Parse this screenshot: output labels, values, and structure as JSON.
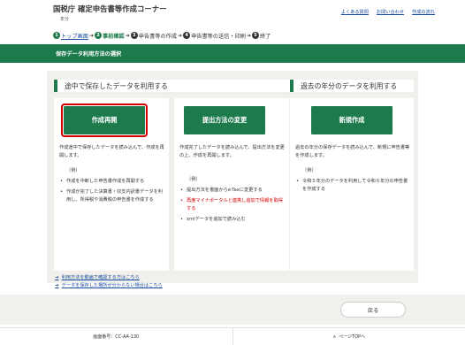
{
  "header": {
    "title": "国税庁 確定申告書等作成コーナー",
    "year": "年分",
    "links": [
      {
        "label": "よくある質問"
      },
      {
        "label": "お問い合わせ"
      },
      {
        "label": "作成の流れ"
      }
    ]
  },
  "steps": [
    {
      "num": "1",
      "label": "トップ画面",
      "state": "done"
    },
    {
      "num": "2",
      "label": "事前確認",
      "state": "current"
    },
    {
      "num": "3",
      "label": "申告書等の作成",
      "state": "todo"
    },
    {
      "num": "4",
      "label": "申告書等の送信・印刷",
      "state": "todo"
    },
    {
      "num": "5",
      "label": "終了",
      "state": "todo"
    }
  ],
  "page_title": "保存データ利用方法の選択",
  "sections": {
    "continue_title": "途中で保存したデータを利用する",
    "past_title": "過去の年分のデータを利用する"
  },
  "cards": [
    {
      "button": "作成再開",
      "desc": "作成途中で保存したデータを読み込んで、作成を再開します。",
      "example": "（例）",
      "items": [
        {
          "text": "作成を中断した申告書作成を再開する",
          "red": false
        },
        {
          "text": "作成が完了した決算書・収支内訳書データを利用し、所得税や消費税の申告書を作成する",
          "red": false
        }
      ]
    },
    {
      "button": "提出方法の変更",
      "desc": "作成完了したデータを読み込んで、提出方法を変更の上、作成を再開します。",
      "example": "（例）",
      "items": [
        {
          "text": "提出方法を書面からe-Taxに変更する",
          "red": false
        },
        {
          "text": "再度マイナポータルと連携し追加で情報を取得する",
          "red": true
        },
        {
          "text": "xmlデータを追加で読み込む",
          "red": false
        }
      ]
    },
    {
      "button": "新規作成",
      "desc": "過去の年分の保存データを読み込んで、新規に申告書等を作成します。",
      "example": "（例）",
      "items": [
        {
          "text": "令和５年分のデータを利用して令和６年分の申告書を作成する",
          "red": false
        }
      ]
    }
  ],
  "links": [
    {
      "label": "利用方法を動画で確認する方はこちら"
    },
    {
      "label": "データを保存した場所が分からない場合はこちら"
    }
  ],
  "back_label": "戻る",
  "footer": {
    "screen_id": "画面番号：CC-AA-130",
    "page_top": "ページTOPへ"
  },
  "colors": {
    "accent_green": "#1d7a4c",
    "selected_outline": "#d40000",
    "link_blue": "#1a4fa0",
    "panel_bg": "#f1f0ec"
  }
}
